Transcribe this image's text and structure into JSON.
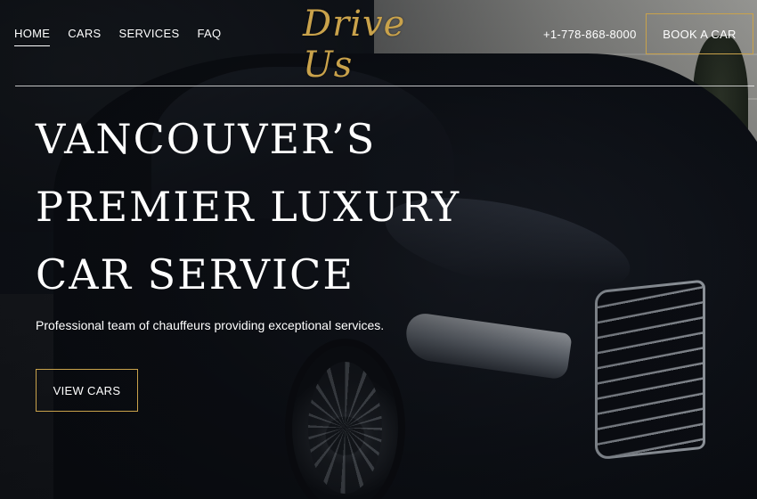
{
  "nav": {
    "links": [
      {
        "label": "HOME",
        "active": true
      },
      {
        "label": "CARS",
        "active": false
      },
      {
        "label": "SERVICES",
        "active": false
      },
      {
        "label": "FAQ",
        "active": false
      }
    ],
    "logo_text": "Drive Us",
    "phone": "+1-778-868-8000",
    "book_label": "BOOK A CAR"
  },
  "hero": {
    "headline_lines": [
      "VANCOUVER’S",
      "PREMIER LUXURY",
      "CAR SERVICE"
    ],
    "subtitle": "Professional team of chauffeurs providing exceptional services.",
    "cta_label": "VIEW CARS"
  },
  "colors": {
    "accent_gold": "#c9a24b",
    "text": "#ffffff",
    "dark_bg": "#0f1218"
  }
}
